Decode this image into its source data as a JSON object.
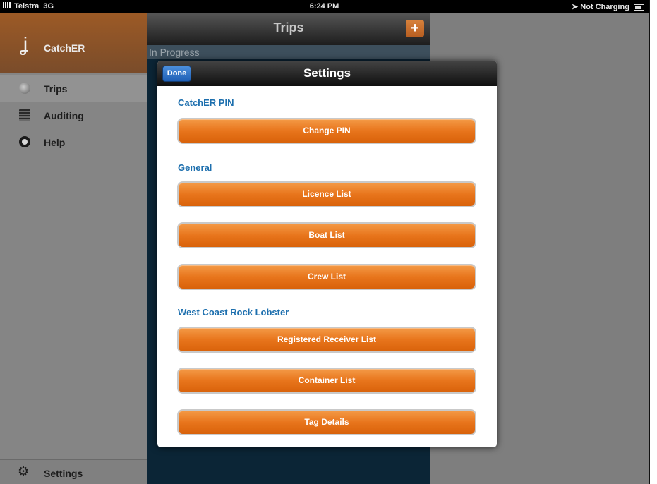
{
  "statusbar": {
    "carrier": "Telstra",
    "network": "3G",
    "time": "6:24 PM",
    "battery_status": "Not Charging"
  },
  "sidebar": {
    "brand": "CatchER",
    "items": [
      {
        "label": "Trips",
        "icon": "globe-icon"
      },
      {
        "label": "Auditing",
        "icon": "document-icon"
      },
      {
        "label": "Help",
        "icon": "lifebuoy-icon"
      }
    ],
    "settings_label": "Settings"
  },
  "trips": {
    "title": "Trips",
    "add_label": "+",
    "section": "In Progress"
  },
  "modal": {
    "title": "Settings",
    "done_label": "Done",
    "sections": [
      {
        "heading": "CatchER PIN",
        "buttons": [
          "Change PIN"
        ]
      },
      {
        "heading": "General",
        "buttons": [
          "Licence List",
          "Boat List",
          "Crew List"
        ]
      },
      {
        "heading": "West Coast Rock Lobster",
        "buttons": [
          "Registered Receiver List",
          "Container List",
          "Tag Details"
        ]
      }
    ]
  },
  "colors": {
    "accent_orange": "#e8751c",
    "section_blue": "#1d6fae",
    "done_blue": "#2f73c8"
  }
}
